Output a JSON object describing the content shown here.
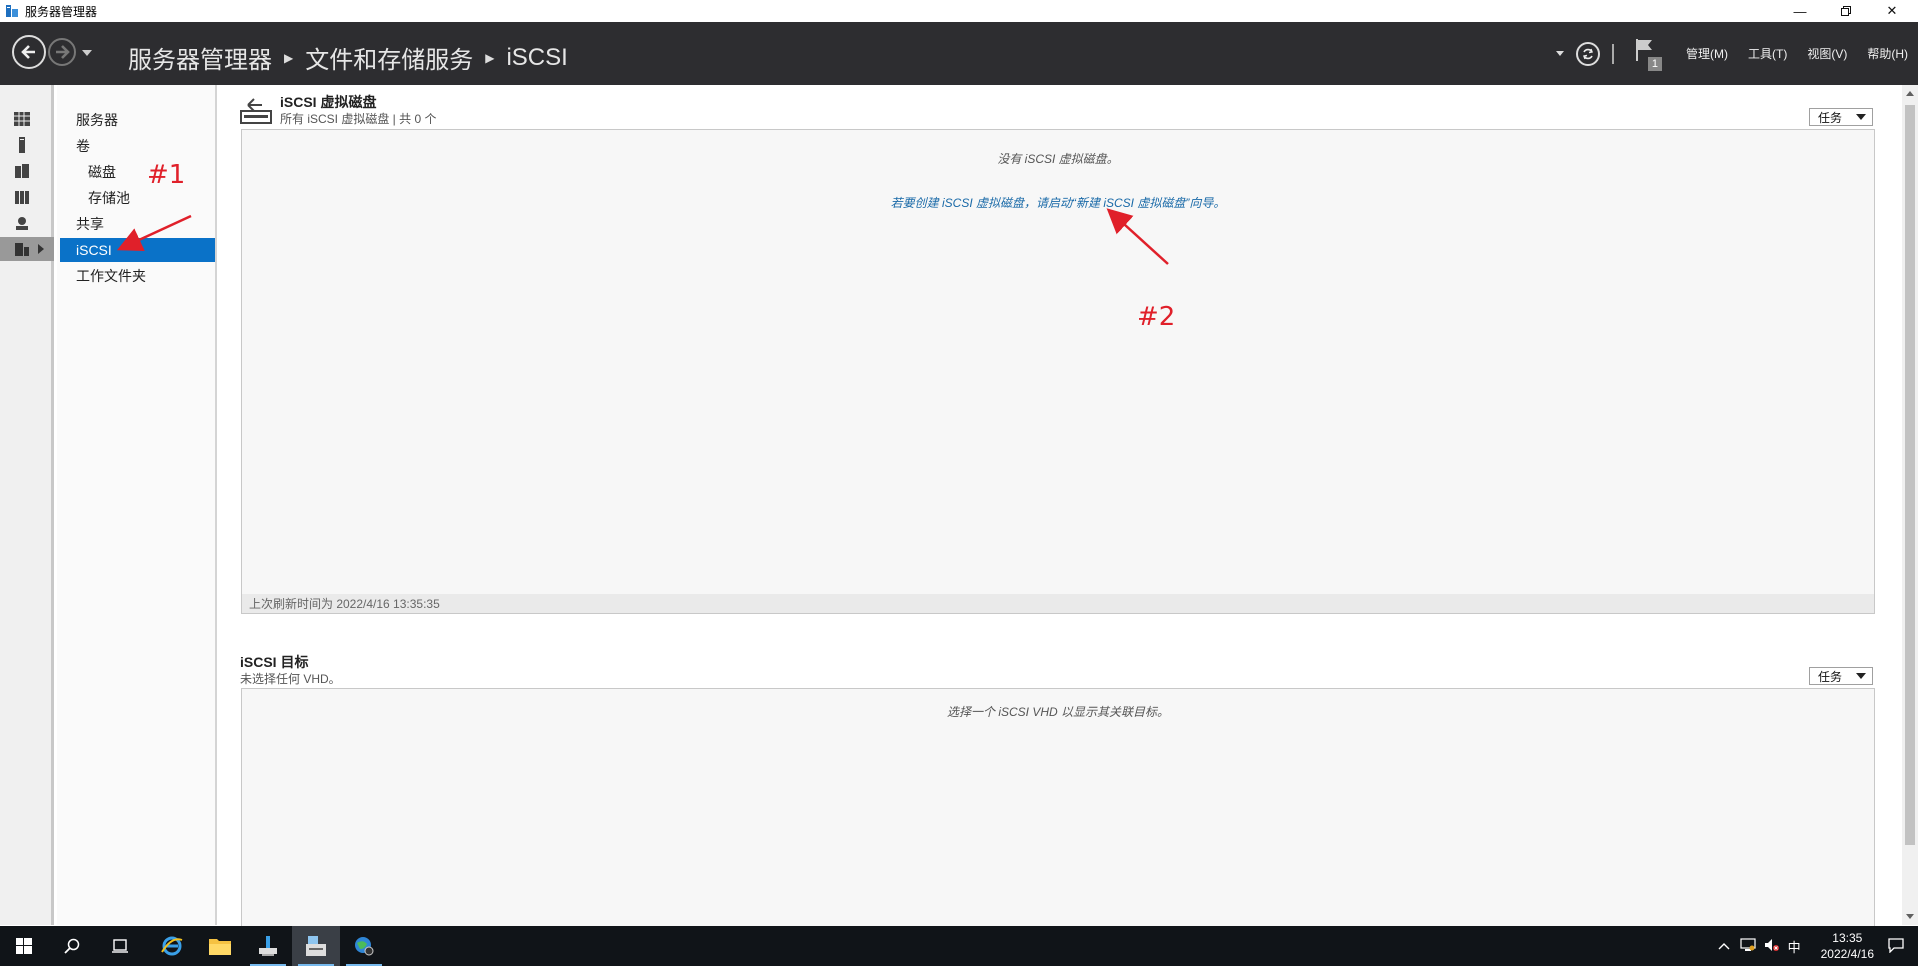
{
  "window": {
    "title": "服务器管理器",
    "controls": [
      "minimize-icon",
      "restore-icon",
      "close-icon"
    ]
  },
  "header": {
    "breadcrumb": [
      "服务器管理器",
      "文件和存储服务",
      "iSCSI"
    ],
    "menus": [
      "管理(M)",
      "工具(T)",
      "视图(V)",
      "帮助(H)"
    ],
    "flag_count": "1"
  },
  "nav": {
    "items": [
      {
        "label": "服务器",
        "sub": false
      },
      {
        "label": "卷",
        "sub": false
      },
      {
        "label": "磁盘",
        "sub": true
      },
      {
        "label": "存储池",
        "sub": true
      },
      {
        "label": "共享",
        "sub": false
      },
      {
        "label": "iSCSI",
        "sub": false,
        "selected": true
      },
      {
        "label": "工作文件夹",
        "sub": false
      }
    ]
  },
  "vdisks": {
    "title": "iSCSI 虚拟磁盘",
    "subtitle": "所有 iSCSI 虚拟磁盘 | 共 0 个",
    "tasks_label": "任务",
    "empty_message": "没有 iSCSI 虚拟磁盘。",
    "create_link": "若要创建 iSCSI 虚拟磁盘，请启动“新建 iSCSI 虚拟磁盘”向导。",
    "last_refresh": "上次刷新时间为 2022/4/16 13:35:35"
  },
  "targets": {
    "title": "iSCSI 目标",
    "subtitle": "未选择任何 VHD。",
    "tasks_label": "任务",
    "empty_message": "选择一个 iSCSI VHD 以显示其关联目标。"
  },
  "annotations": {
    "one": "#1",
    "two": "#2",
    "color": "#e0202a"
  },
  "taskbar": {
    "time": "13:35",
    "date": "2022/4/16",
    "ime": "中"
  },
  "colors": {
    "header_bg": "#2d2d30",
    "selected": "#0a72c8",
    "link": "#1a6aa8"
  }
}
